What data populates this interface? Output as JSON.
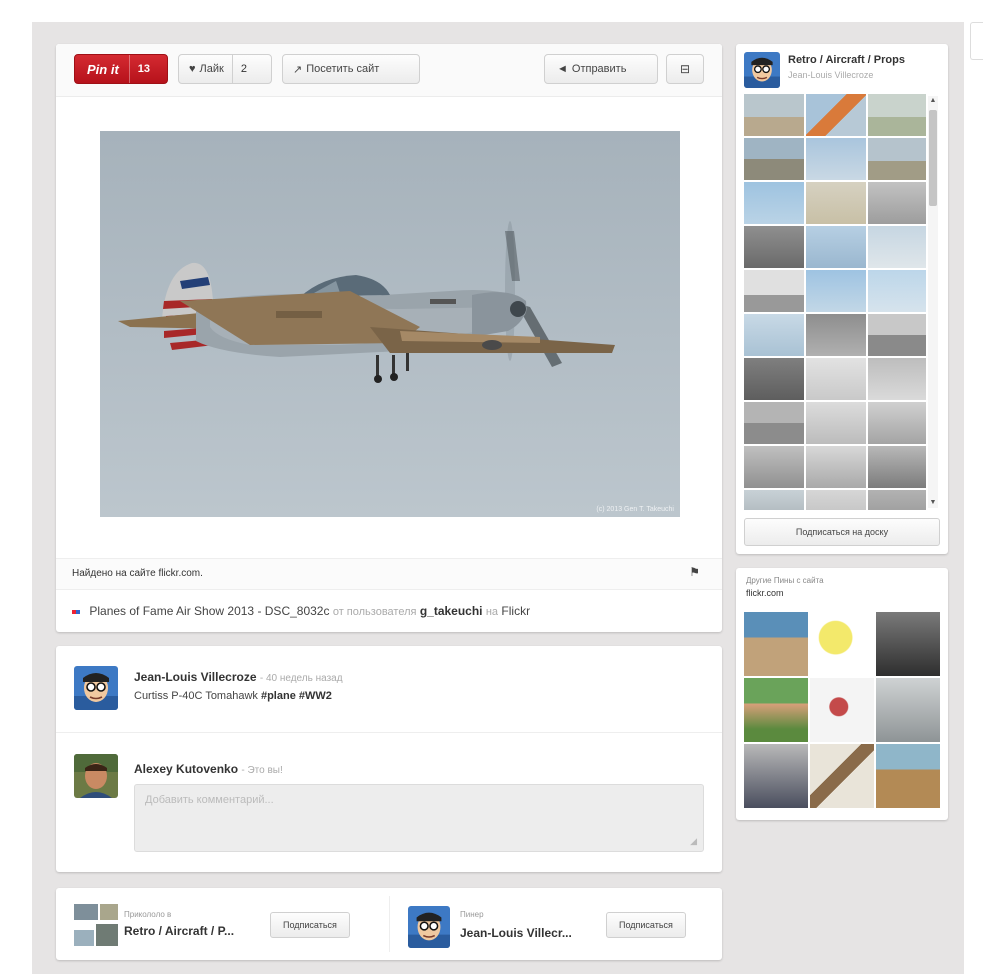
{
  "toolbar": {
    "pinit_label": "Pin it",
    "pin_count": "13",
    "like_label": "Лайк",
    "like_count": "2",
    "visit_label": "Посетить сайт",
    "send_label": "Отправить"
  },
  "photo": {
    "watermark": "(c) 2013 Gen T. Takeuchi"
  },
  "source": {
    "found_on": "Найдено на сайте flickr.com.",
    "title": "Planes of Fame Air Show 2013 - DSC_8032c",
    "from_user": "от пользователя",
    "username": "g_takeuchi",
    "on": "на",
    "site": "Flickr"
  },
  "comments": [
    {
      "author": "Jean-Louis Villecroze",
      "time": "- 40 недель назад",
      "text_prefix": "Curtiss P-40C Tomahawk",
      "tags": "#plane #WW2"
    },
    {
      "author": "Alexey Kutovenko",
      "time": "- Это вы!",
      "placeholder": "Добавить комментарий..."
    }
  ],
  "footer": {
    "pinned_to_label": "Прикололо в",
    "board_name": "Retro / Aircraft / P...",
    "follow_label": "Подписаться",
    "pinner_label": "Пинер",
    "pinner_name": "Jean-Louis Villecr...",
    "follow_label_2": "Подписаться"
  },
  "board": {
    "title": "Retro / Aircraft / Props",
    "owner": "Jean-Louis Villecroze",
    "follow_board": "Подписаться на доску"
  },
  "other_pins": {
    "label": "Другие Пины с сайта",
    "domain": "flickr.com"
  },
  "colors": {
    "pinit_red": "#c8161d",
    "background": "#e6e4e4"
  }
}
